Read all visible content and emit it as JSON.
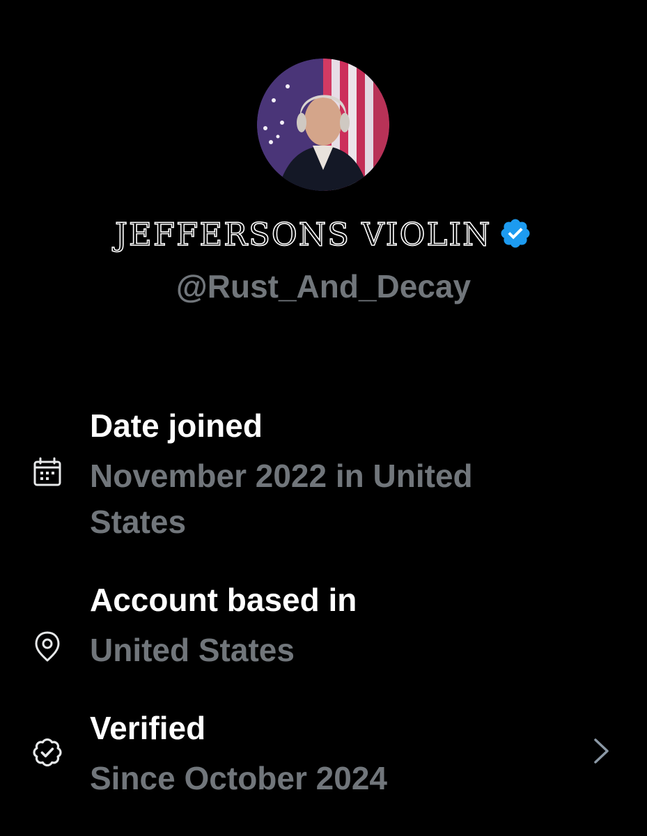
{
  "profile": {
    "display_name": "JEFFERSONS VIOLIN",
    "handle": "@Rust_And_Decay",
    "verified_icon": "verified-badge-icon",
    "badge_color": "#1d9bf0"
  },
  "about": {
    "date_joined": {
      "icon": "calendar-icon",
      "label": "Date joined",
      "value": "November 2022 in United States"
    },
    "account_based": {
      "icon": "location-pin-icon",
      "label": "Account based in",
      "value": "United States"
    },
    "verified": {
      "icon": "verified-check-icon",
      "label": "Verified",
      "value": "Since October 2024",
      "chevron_icon": "chevron-right-icon"
    }
  },
  "colors": {
    "background": "#000000",
    "primary_text": "#ffffff",
    "secondary_text": "#71767b",
    "accent": "#1d9bf0"
  }
}
